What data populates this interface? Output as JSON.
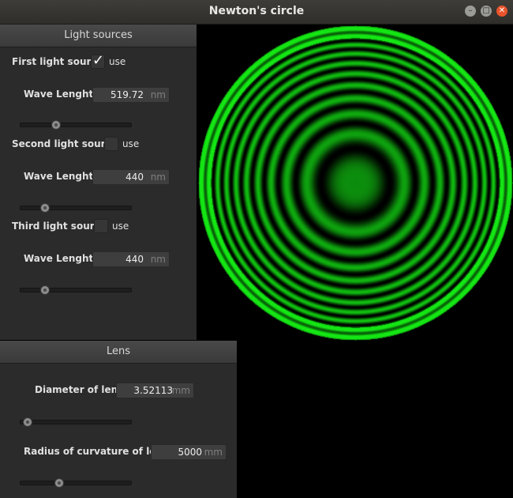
{
  "window": {
    "title": "Newton's circle"
  },
  "light_sources": {
    "heading": "Light sources",
    "use_label": "use",
    "wave_label": "Wave Lenght:",
    "unit": "nm",
    "sources": [
      {
        "label": "First light source",
        "checked": true,
        "value": "519.72",
        "slider": 0.3
      },
      {
        "label": "Second light source",
        "checked": false,
        "value": "440",
        "slider": 0.19
      },
      {
        "label": "Third light source",
        "checked": false,
        "value": "440",
        "slider": 0.19
      }
    ]
  },
  "lens": {
    "heading": "Lens",
    "diameter_label": "Diameter of lens:",
    "diameter_value": "3.52113",
    "diameter_unit": "mm",
    "diameter_slider": 0.02,
    "radius_label": "Radius of curvature of lens:",
    "radius_value": "5000",
    "radius_unit": "mm",
    "radius_slider": 0.33
  },
  "view": {
    "color": "#19e619",
    "background": "#000000"
  }
}
